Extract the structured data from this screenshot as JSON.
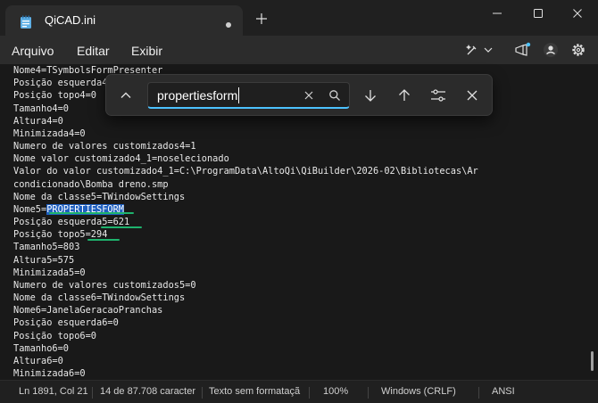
{
  "window": {
    "tab_title": "QiCAD.ini",
    "new_tab_label": "+"
  },
  "menu": {
    "items": [
      "Arquivo",
      "Editar",
      "Exibir"
    ]
  },
  "find": {
    "query": "propertiesform"
  },
  "editor": {
    "lines": [
      "Nome4=TSymbolsFormPresenter",
      "Posição esquerda4=0",
      "Posição topo4=0",
      "Tamanho4=0",
      "Altura4=0",
      "Minimizada4=0",
      "Numero de valores customizados4=1",
      "Nome valor customizado4_1=noselecionado",
      "Valor do valor customizado4_1=C:\\ProgramData\\AltoQi\\QiBuilder\\2026-02\\Bibliotecas\\Ar",
      "condicionado\\Bomba dreno.smp",
      "Nome da classe5=TWindowSettings",
      "Nome5=PROPERTIESFORM",
      "Posição esquerda5=621",
      "Posição topo5=294",
      "Tamanho5=803",
      "Altura5=575",
      "Minimizada5=0",
      "Numero de valores customizados5=0",
      "Nome da classe6=TWindowSettings",
      "Nome6=JanelaGeracaoPranchas",
      "Posição esquerda6=0",
      "Posição topo6=0",
      "Tamanho6=0",
      "Altura6=0",
      "Minimizada6=0"
    ],
    "match": {
      "prefix": "Nome5=",
      "text": "PROPERTIESFORM"
    }
  },
  "status": {
    "position": "Ln 1891, Col 21",
    "selection": "14 de 87.708 caracter",
    "format": "Texto sem formataçã",
    "zoom": "100%",
    "line_ending": "Windows (CRLF)",
    "encoding": "ANSI"
  },
  "colors": {
    "accent": "#4cc2ff",
    "highlight": "#1f5fbf",
    "annotation_underline": "#1eb36d"
  }
}
